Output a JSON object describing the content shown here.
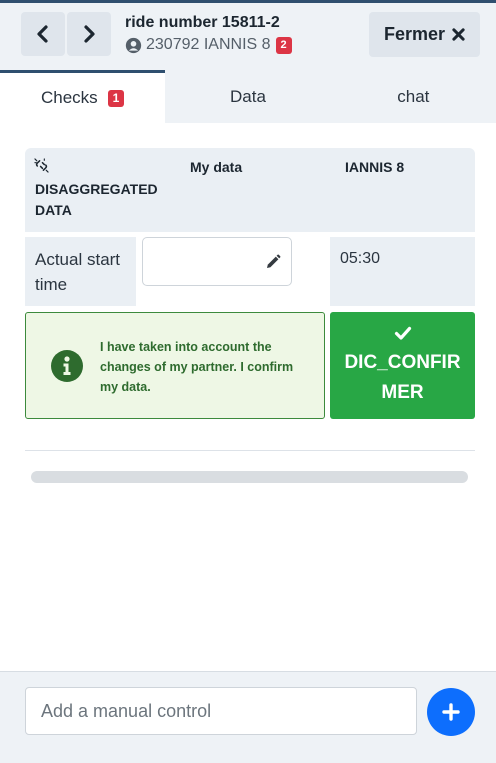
{
  "header": {
    "prev_icon": "chevron-left-icon",
    "next_icon": "chevron-right-icon",
    "ride_title": "ride number 15811-2",
    "user_icon": "user-circle-icon",
    "partner_info": "230792 IANNIS 8",
    "partner_badge": "2",
    "close_label": "Fermer",
    "close_icon": "times-icon"
  },
  "tabs": [
    {
      "label": "Checks",
      "badge": "1",
      "active": true
    },
    {
      "label": "Data",
      "active": false
    },
    {
      "label": "chat",
      "active": false
    }
  ],
  "table": {
    "unlink_icon": "unlink-icon",
    "disaggregated_label": "DISAGGREGATED DATA",
    "my_data_header": "My data",
    "partner_header": "IANNIS 8",
    "rows": [
      {
        "label": "Actual start time",
        "my_value": "",
        "partner_value": "05:30"
      }
    ]
  },
  "info": {
    "icon": "info-circle-icon",
    "text": "I have taken into account the changes of my partner. I confirm my data."
  },
  "confirm": {
    "icon": "check-icon",
    "label": "DIC_CONFIRMER"
  },
  "footer": {
    "placeholder": "Add a manual control",
    "add_icon": "plus-icon"
  },
  "colors": {
    "accent_blue": "#0d6efd",
    "success_green": "#28a745",
    "badge_red": "#dc3545",
    "header_bg": "#eef2f6"
  }
}
